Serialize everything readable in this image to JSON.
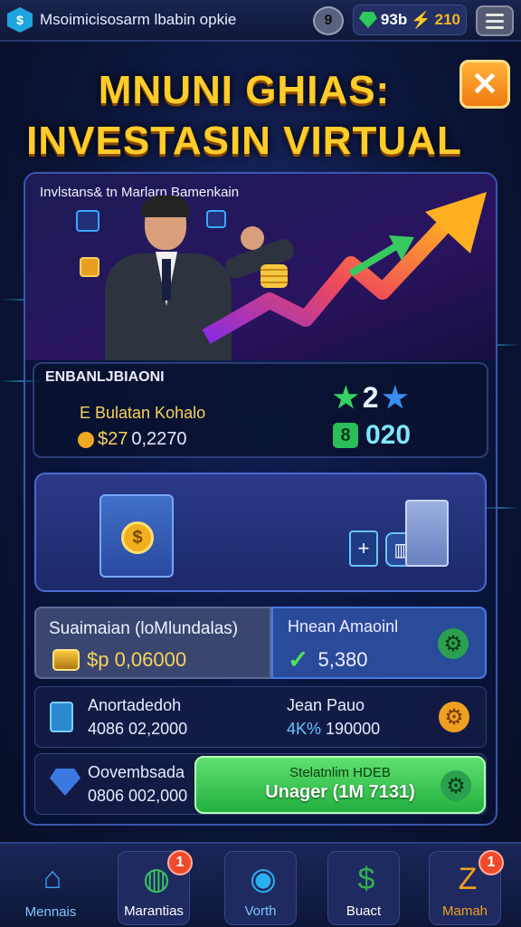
{
  "header": {
    "app_title": "Msoimicisosarm lbabin opkie",
    "clock_value": "9",
    "gems": "93b",
    "energy": "210"
  },
  "headline": {
    "line1": "MNUNI GHIAS:",
    "line2": "INVESTASIN VIRTUAL"
  },
  "hero": {
    "caption": "Invlstans& tn Marlarn Bamenkain"
  },
  "stats": {
    "heading": "ENBANLJBIAONI",
    "subtitle": "E Bulatan Kohalo",
    "value_prefix": "$27",
    "value": "0,2270",
    "stars": "2",
    "cash_badge": "8",
    "cash_value": "020"
  },
  "row3": {
    "left_title": "Suaimaian (loMlundalas)",
    "left_value": "$p 0,06000",
    "right_title": "Hnean Amaoinl",
    "right_value": "5,380"
  },
  "row4": {
    "left_title": "Anortadedoh",
    "left_value": "4086 02,2000",
    "right_title": "Jean Pauo",
    "right_prefix": "4K%",
    "right_value": "190000"
  },
  "row5": {
    "left_title": "Oovembsada",
    "left_value": "0806 002,000",
    "button_line1": "Stelatnlim HDEB",
    "button_line2": "Unager (1M 7131)"
  },
  "nav": [
    {
      "label": "Mennais",
      "icon": "home-icon",
      "color": "#3aa0f0"
    },
    {
      "label": "Marantias",
      "icon": "chart-icon",
      "color": "#38c860",
      "badge": "1"
    },
    {
      "label": "Vorth",
      "icon": "globe-icon",
      "color": "#2ab0f0"
    },
    {
      "label": "Buact",
      "icon": "dollar-shield-icon",
      "color": "#30b050"
    },
    {
      "label": "Mamah",
      "icon": "trophy-icon",
      "color": "#f0a020",
      "badge": "1"
    }
  ],
  "colors": {
    "gold": "#ffcc2a",
    "green": "#2bbf5a",
    "accent_blue": "#3b56b0",
    "badge_red": "#f04a2a"
  }
}
